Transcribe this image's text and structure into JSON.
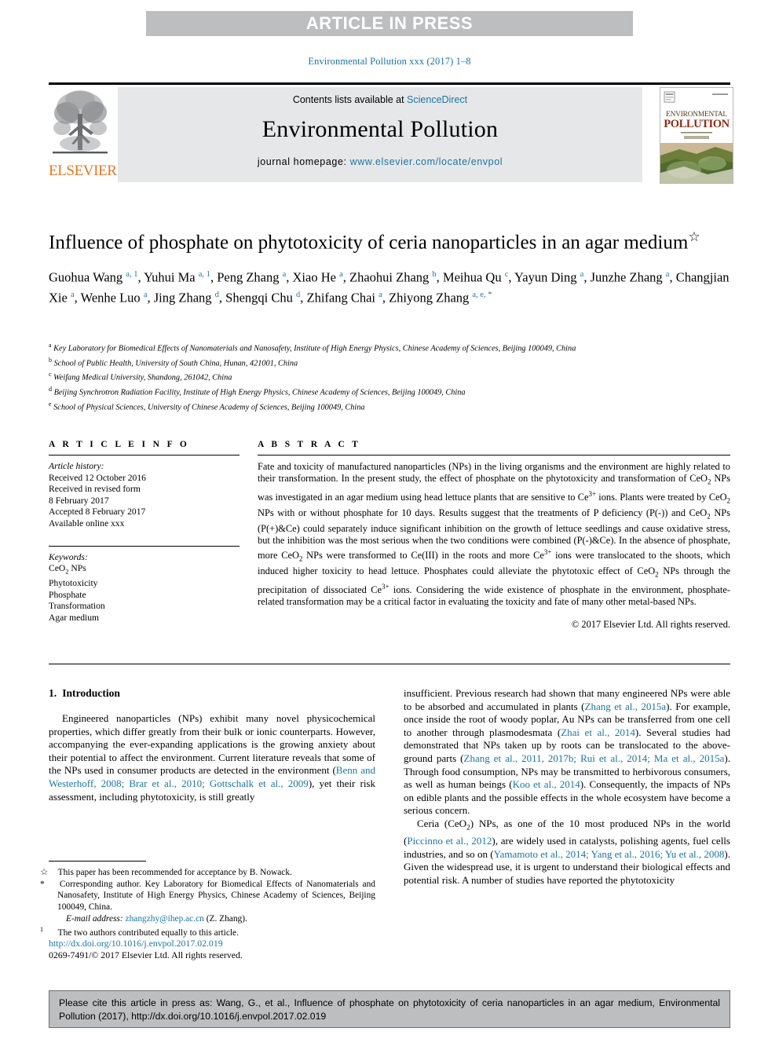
{
  "banner": {
    "label": "ARTICLE IN PRESS",
    "bg_color": "#bcbec0",
    "text_color": "#ffffff"
  },
  "running_head": "Environmental Pollution xxx (2017) 1–8",
  "masthead": {
    "contents_prefix": "Contents lists available at ",
    "contents_link": "ScienceDirect",
    "journal_name": "Environmental Pollution",
    "homepage_prefix": "journal homepage: ",
    "homepage_link": "www.elsevier.com/locate/envpol",
    "publisher_wordmark": "ELSEVIER",
    "publisher_color": "#e87722",
    "link_color": "#1a75a7",
    "panel_bg": "#e6e7e8",
    "cover_title_line1": "ENVIRONMENTAL",
    "cover_title_line2": "POLLUTION"
  },
  "article": {
    "title": "Influence of phosphate on phytotoxicity of ceria nanoparticles in an agar medium",
    "title_footnote_symbol": "☆",
    "authors": [
      {
        "name": "Guohua Wang",
        "sup": "a, 1",
        "sep": ", "
      },
      {
        "name": "Yuhui Ma",
        "sup": "a, 1",
        "sep": ", "
      },
      {
        "name": "Peng Zhang",
        "sup": "a",
        "sep": ", "
      },
      {
        "name": "Xiao He",
        "sup": "a",
        "sep": ", "
      },
      {
        "name": "Zhaohui Zhang",
        "sup": "b",
        "sep": ", "
      },
      {
        "name": "Meihua Qu",
        "sup": "c",
        "sep": ", "
      },
      {
        "name": "Yayun Ding",
        "sup": "a",
        "sep": ", "
      },
      {
        "name": "Junzhe Zhang",
        "sup": "a",
        "sep": ", "
      },
      {
        "name": "Changjian Xie",
        "sup": "a",
        "sep": ", "
      },
      {
        "name": "Wenhe Luo",
        "sup": "a",
        "sep": ", "
      },
      {
        "name": "Jing Zhang",
        "sup": "d",
        "sep": ", "
      },
      {
        "name": "Shengqi Chu",
        "sup": "d",
        "sep": ", "
      },
      {
        "name": "Zhifang Chai",
        "sup": "a",
        "sep": ", "
      },
      {
        "name": "Zhiyong Zhang",
        "sup": "a, e, *",
        "sep": ""
      }
    ],
    "affiliations": [
      {
        "marker": "a",
        "text": "Key Laboratory for Biomedical Effects of Nanomaterials and Nanosafety, Institute of High Energy Physics, Chinese Academy of Sciences, Beijing 100049, China"
      },
      {
        "marker": "b",
        "text": "School of Public Health, University of South China, Hunan, 421001, China"
      },
      {
        "marker": "c",
        "text": "Weifang Medical University, Shandong, 261042, China"
      },
      {
        "marker": "d",
        "text": "Beijing Synchrotron Radiation Facility, Institute of High Energy Physics, Chinese Academy of Sciences, Beijing 100049, China"
      },
      {
        "marker": "e",
        "text": "School of Physical Sciences, University of Chinese Academy of Sciences, Beijing 100049, China"
      }
    ]
  },
  "article_info": {
    "heading": "A R T I C L E  I N F O",
    "history_label": "Article history:",
    "history": [
      "Received 12 October 2016",
      "Received in revised form",
      "8 February 2017",
      "Accepted 8 February 2017",
      "Available online xxx"
    ],
    "keywords_label": "Keywords:",
    "keywords": [
      "CeO2 NPs",
      "Phytotoxicity",
      "Phosphate",
      "Transformation",
      "Agar medium"
    ]
  },
  "abstract": {
    "heading": "A B S T R A C T",
    "copyright": "© 2017 Elsevier Ltd. All rights reserved."
  },
  "introduction": {
    "heading_number": "1.",
    "heading_text": "Introduction"
  },
  "footnotes": {
    "star": "This paper has been recommended for acceptance by B. Nowack.",
    "star_symbol": "☆",
    "corresponding_symbol": "*",
    "corresponding": "Corresponding author. Key Laboratory for Biomedical Effects of Nanomaterials and Nanosafety, Institute of High Energy Physics, Chinese Academy of Sciences, Beijing 100049, China.",
    "email_label": "E-mail address:",
    "email": "zhangzhy@ihep.ac.cn",
    "email_owner": "(Z. Zhang).",
    "note_marker": "1",
    "note": "The two authors contributed equally to this article."
  },
  "doi_block": {
    "doi_url": "http://dx.doi.org/10.1016/j.envpol.2017.02.019",
    "issn_line": "0269-7491/© 2017 Elsevier Ltd. All rights reserved."
  },
  "cite_box": {
    "text": "Please cite this article in press as: Wang, G., et al., Influence of phosphate on phytotoxicity of ceria nanoparticles in an agar medium, Environmental Pollution (2017), http://dx.doi.org/10.1016/j.envpol.2017.02.019",
    "bg_color": "#bcbec0"
  }
}
